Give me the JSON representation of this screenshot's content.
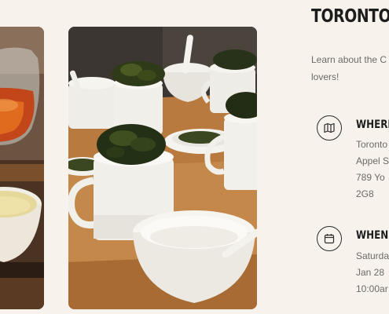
{
  "event": {
    "title": "TORONTO",
    "intro_lines": [
      "Learn about the C",
      "lovers!"
    ]
  },
  "where": {
    "heading": "WHERE",
    "icon": "map-icon",
    "lines": [
      "Toronto",
      "Appel S",
      "789 Yo",
      "2G8"
    ]
  },
  "when": {
    "heading": "WHEN",
    "icon": "calendar-icon",
    "lines": [
      "Saturda",
      "Jan 28",
      "10:00ar"
    ]
  },
  "photos": [
    {
      "name": "tea-pouring-photo"
    },
    {
      "name": "tea-tasting-cups-photo"
    }
  ]
}
